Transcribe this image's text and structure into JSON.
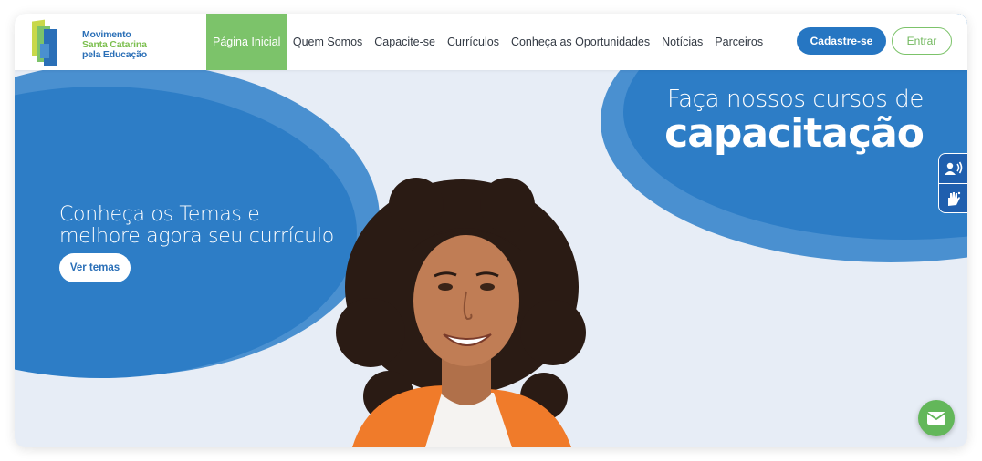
{
  "brand": {
    "line1": "Movimento",
    "line2": "Santa Catarina",
    "line3": "pela Educação"
  },
  "nav": {
    "items": [
      {
        "label": "Página Inicial",
        "active": true
      },
      {
        "label": "Quem Somos",
        "active": false
      },
      {
        "label": "Capacite-se",
        "active": false
      },
      {
        "label": "Currículos",
        "active": false
      },
      {
        "label": "Conheça as Oportunidades",
        "active": false
      },
      {
        "label": "Notícias",
        "active": false
      },
      {
        "label": "Parceiros",
        "active": false
      }
    ]
  },
  "header_actions": {
    "register_label": "Cadastre-se",
    "login_label": "Entrar"
  },
  "hero": {
    "left_title_line1": "Conheça os Temas e",
    "left_title_line2": "melhore agora seu currículo",
    "left_button": "Ver temas",
    "right_subtitle": "Faça nossos cursos de",
    "right_title": "capacitação"
  },
  "accessibility": {
    "icons": [
      "audio-description-icon",
      "sign-language-icon"
    ]
  },
  "floating": {
    "icon": "envelope-icon"
  },
  "colors": {
    "primary_blue": "#2676c2",
    "light_blue": "#4a90d0",
    "accent_green": "#7cc36a",
    "hero_bg": "#e7edf6"
  }
}
